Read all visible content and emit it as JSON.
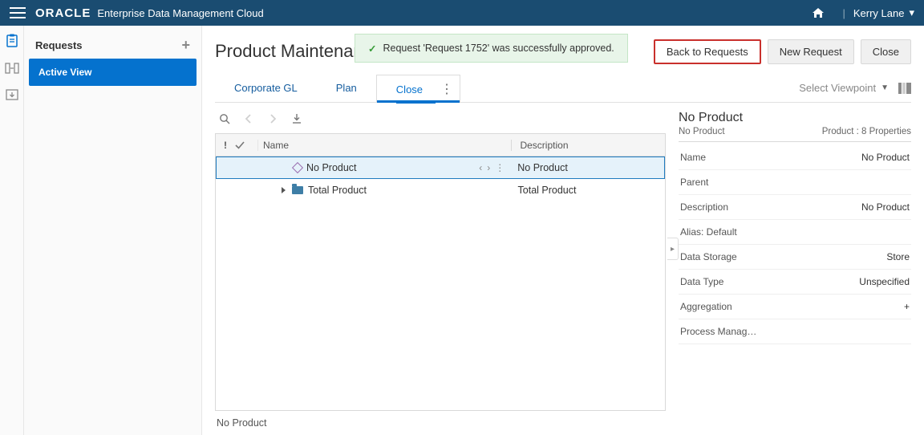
{
  "topbar": {
    "brand_logo": "ORACLE",
    "brand_name": "Enterprise Data Management Cloud",
    "user": "Kerry Lane"
  },
  "sidebar": {
    "header": "Requests",
    "active_item": "Active View"
  },
  "page": {
    "title": "Product Maintenance",
    "notification": "Request 'Request 1752' was successfully approved."
  },
  "actions": {
    "back": "Back to Requests",
    "new": "New Request",
    "close": "Close"
  },
  "tabs": {
    "items": [
      "Corporate GL",
      "Plan",
      "Close"
    ],
    "active_index": 2,
    "select_viewpoint": "Select Viewpoint"
  },
  "grid": {
    "headers": {
      "flag": "!",
      "name": "Name",
      "description": "Description"
    },
    "rows": [
      {
        "name": "No Product",
        "description": "No Product",
        "icon": "diamond",
        "selected": true
      },
      {
        "name": "Total Product",
        "description": "Total Product",
        "icon": "folder",
        "expandable": true
      }
    ],
    "status": "No Product"
  },
  "props": {
    "title": "No Product",
    "subtitle_left": "No Product",
    "subtitle_right": "Product : 8 Properties",
    "rows": [
      {
        "label": "Name",
        "value": "No Product"
      },
      {
        "label": "Parent",
        "value": ""
      },
      {
        "label": "Description",
        "value": "No Product"
      },
      {
        "label": "Alias: Default",
        "value": ""
      },
      {
        "label": "Data Storage",
        "value": "Store"
      },
      {
        "label": "Data Type",
        "value": "Unspecified"
      },
      {
        "label": "Aggregation",
        "value": "+"
      },
      {
        "label": "Process Manag…",
        "value": ""
      }
    ]
  }
}
